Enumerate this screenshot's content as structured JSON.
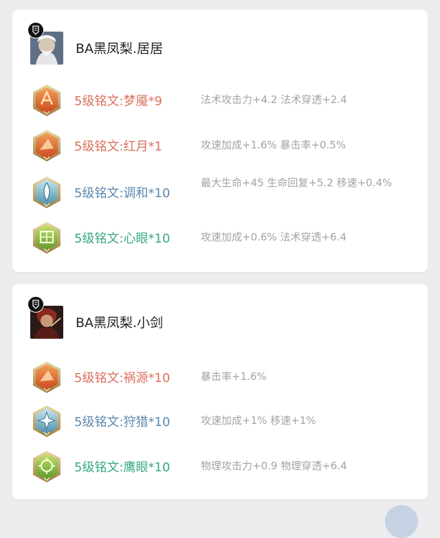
{
  "cards": [
    {
      "hero_name": "BA黑凤梨.居居",
      "runes": [
        {
          "name": "5级铭文:梦魇*9",
          "desc": "法术攻击力+4.2 法术穿透+2.4",
          "color": "red",
          "icon": "nightmare-rune"
        },
        {
          "name": "5级铭文:红月*1",
          "desc": "攻速加成+1.6% 暴击率+0.5%",
          "color": "red",
          "icon": "red-moon-rune"
        },
        {
          "name": "5级铭文:调和*10",
          "desc": "最大生命+45 生命回复+5.2 移速+0.4%",
          "color": "blue",
          "icon": "harmony-rune"
        },
        {
          "name": "5级铭文:心眼*10",
          "desc": "攻速加成+0.6% 法术穿透+6.4",
          "color": "green",
          "icon": "mind-eye-rune"
        }
      ]
    },
    {
      "hero_name": "BA黑凤梨.小剑",
      "runes": [
        {
          "name": "5级铭文:祸源*10",
          "desc": "暴击率+1.6%",
          "color": "red",
          "icon": "calamity-rune"
        },
        {
          "name": "5级铭文:狩猎*10",
          "desc": "攻速加成+1% 移速+1%",
          "color": "blue",
          "icon": "hunt-rune"
        },
        {
          "name": "5级铭文:鹰眼*10",
          "desc": "物理攻击力+0.9 物理穿透+6.4",
          "color": "green",
          "icon": "hawk-eye-rune"
        }
      ]
    }
  ],
  "colors": {
    "red": "#d9715e",
    "blue": "#5d88ad",
    "green": "#39a883",
    "desc": "#a3a3a3",
    "background": "#ececee"
  }
}
